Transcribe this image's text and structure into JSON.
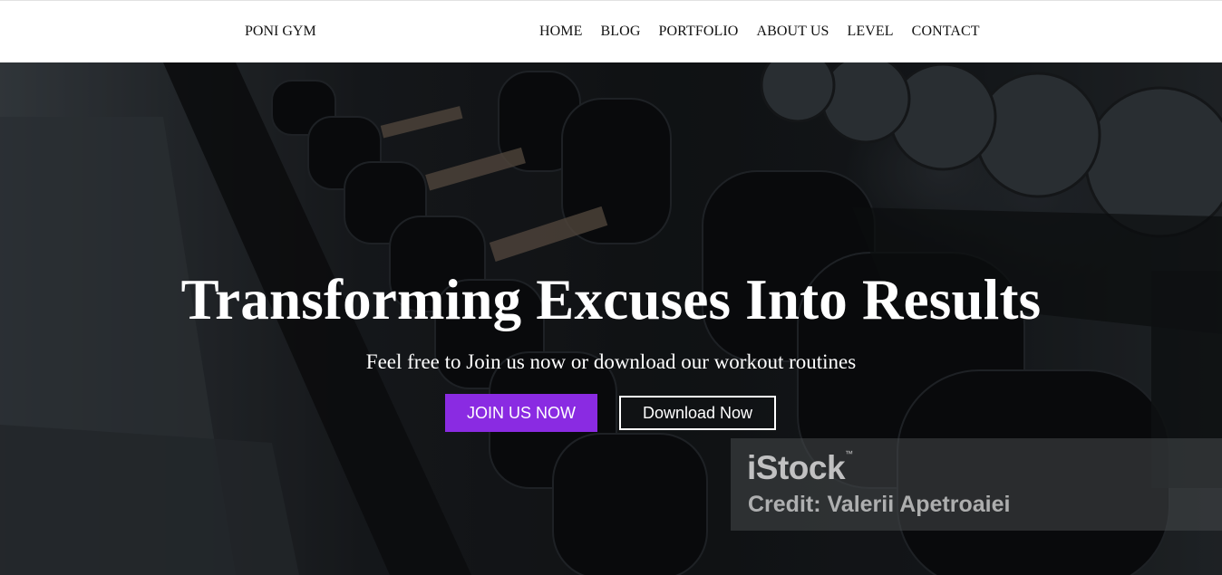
{
  "navbar": {
    "brand": "PONI GYM",
    "links": [
      "HOME",
      "BLOG",
      "PORTFOLIO",
      "ABOUT US",
      "LEVEL",
      "CONTACT"
    ]
  },
  "hero": {
    "title": "Transforming Excuses Into Results",
    "subtitle": "Feel free to Join us now or download our workout routines",
    "join_button": "JOIN US NOW",
    "download_button": "Download Now",
    "background": "gym-dumbbell-rack-photo"
  },
  "watermark": {
    "logo": "iStock",
    "trademark": "™",
    "credit": "Credit: Valerii Apetroaiei"
  },
  "colors": {
    "accent": "#8a2be2",
    "nav_bg": "#ffffff",
    "hero_text": "#ffffff"
  }
}
